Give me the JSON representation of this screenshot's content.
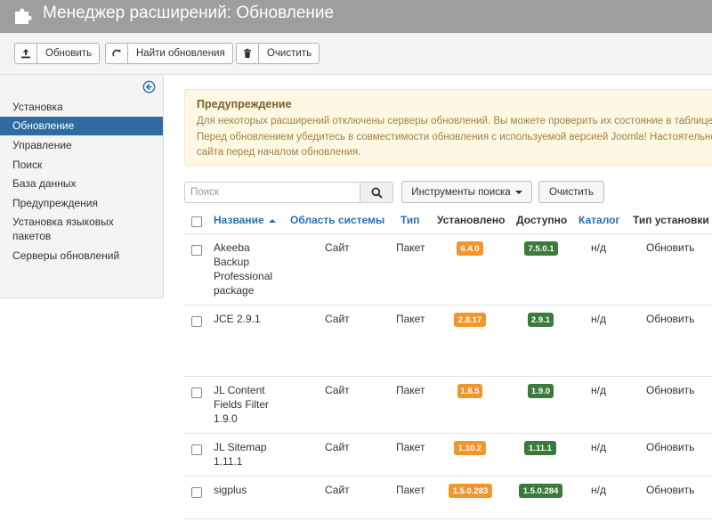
{
  "header": {
    "title": "Менеджер расширений: Обновление",
    "icon": "puzzle-icon"
  },
  "toolbar": {
    "update_label": "Обновить",
    "find_updates_label": "Найти обновления",
    "clear_label": "Очистить"
  },
  "sidebar": {
    "items": [
      {
        "label": "Установка"
      },
      {
        "label": "Обновление"
      },
      {
        "label": "Управление"
      },
      {
        "label": "Поиск"
      },
      {
        "label": "База данных"
      },
      {
        "label": "Предупреждения"
      },
      {
        "label": "Установка языковых пакетов"
      },
      {
        "label": "Серверы обновлений"
      }
    ]
  },
  "alert": {
    "title": "Предупреждение",
    "lines": [
      "Для некоторых расширений отключены серверы обновлений. Вы можете проверить их состояние в таблице",
      "Перед обновлением убедитесь в совместимости обновления с используемой версией Joomla! Настоятельно",
      "сайта перед началом обновления."
    ]
  },
  "filters": {
    "search_placeholder": "Поиск",
    "search_tools_label": "Инструменты поиска",
    "clear_label": "Очистить"
  },
  "table": {
    "headers": {
      "name": "Название",
      "location": "Область системы",
      "type": "Тип",
      "installed": "Установлено",
      "available": "Доступно",
      "folder": "Каталог",
      "install_type": "Тип установки"
    },
    "rows": [
      {
        "name": "Akeeba Backup Professional package",
        "location": "Сайт",
        "type": "Пакет",
        "installed": "6.4.0",
        "available": "7.5.0.1",
        "folder": "н/д",
        "install_type": "Обновить"
      },
      {
        "name": "JCE 2.9.1",
        "location": "Сайт",
        "type": "Пакет",
        "installed": "2.8.17",
        "available": "2.9.1",
        "folder": "н/д",
        "install_type": "Обновить"
      },
      {
        "name": "JL Content Fields Filter 1.9.0",
        "location": "Сайт",
        "type": "Пакет",
        "installed": "1.8.5",
        "available": "1.9.0",
        "folder": "н/д",
        "install_type": "Обновить"
      },
      {
        "name": "JL Sitemap 1.11.1",
        "location": "Сайт",
        "type": "Пакет",
        "installed": "1.10.2",
        "available": "1.11.1",
        "folder": "н/д",
        "install_type": "Обновить"
      },
      {
        "name": "sigplus",
        "location": "Сайт",
        "type": "Пакет",
        "installed": "1.5.0.283",
        "available": "1.5.0.284",
        "folder": "н/д",
        "install_type": "Обновить"
      }
    ]
  },
  "colors": {
    "accent": "#2d6ca2",
    "installed_badge": "#f0962c",
    "available_badge": "#3b7a3a",
    "header_bg": "#9e9e9e"
  }
}
